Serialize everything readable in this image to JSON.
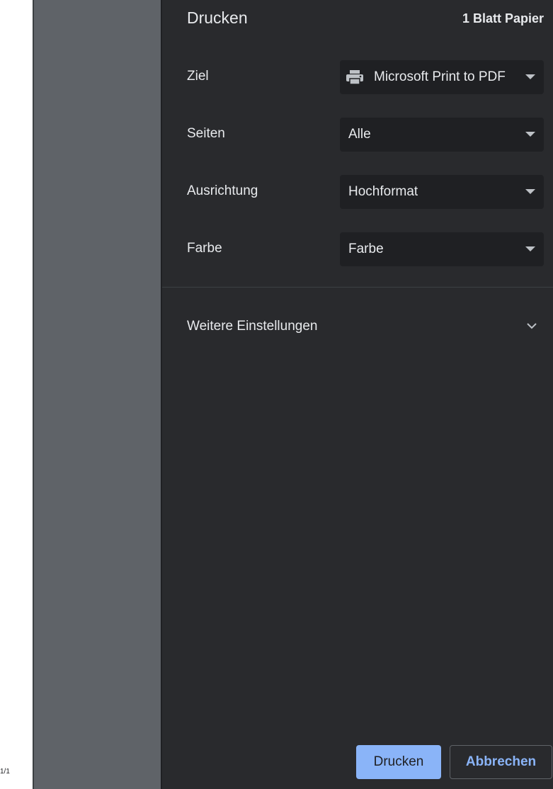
{
  "preview": {
    "page_indicator": "1/1"
  },
  "header": {
    "title": "Drucken",
    "sheet_count": "1 Blatt Papier"
  },
  "settings": [
    {
      "label": "Ziel",
      "value": "Microsoft Print to PDF",
      "icon": "printer-icon"
    },
    {
      "label": "Seiten",
      "value": "Alle"
    },
    {
      "label": "Ausrichtung",
      "value": "Hochformat"
    },
    {
      "label": "Farbe",
      "value": "Farbe"
    }
  ],
  "more_settings": {
    "label": "Weitere Einstellungen",
    "icon": "chevron-down-icon"
  },
  "buttons": {
    "print_label": "Drucken",
    "cancel_label": "Abbrechen"
  },
  "colors": {
    "background": "#292a2d",
    "select_background": "#1f2023",
    "accent": "#8ab4f8",
    "text": "#e8eaed",
    "preview_gray": "#5f6368"
  }
}
